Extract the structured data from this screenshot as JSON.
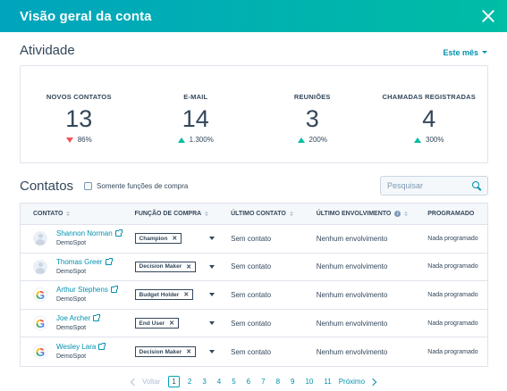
{
  "header": {
    "title": "Visão geral da conta"
  },
  "activity": {
    "title": "Atividade",
    "period": "Este mês",
    "stats": [
      {
        "label": "NOVOS CONTATOS",
        "value": "13",
        "change": "86%",
        "trend": "down"
      },
      {
        "label": "E-MAIL",
        "value": "14",
        "change": "1.300%",
        "trend": "up"
      },
      {
        "label": "REUNIÕES",
        "value": "3",
        "change": "200%",
        "trend": "up"
      },
      {
        "label": "CHAMADAS REGISTRADAS",
        "value": "4",
        "change": "300%",
        "trend": "up"
      }
    ]
  },
  "contacts": {
    "title": "Contatos",
    "filter_label": "Somente funções de compra",
    "search_placeholder": "Pesquisar",
    "columns": [
      "CONTATO",
      "FUNÇÃO DE COMPRA",
      "ÚLTIMO CONTATO",
      "ÚLTIMO ENVOLVIMENTO",
      "PROGRAMADO"
    ],
    "rows": [
      {
        "name": "Shannon Norman",
        "company": "DemoSpot",
        "avatar": "person-icon",
        "role": "Champion",
        "last_contact": "Sem contato",
        "engagement": "Nenhum envolvimento",
        "scheduled": "Nada programado"
      },
      {
        "name": "Thomas Greer",
        "company": "DemoSpot",
        "avatar": "person-icon",
        "role": "Decision Maker",
        "last_contact": "Sem contato",
        "engagement": "Nenhum envolvimento",
        "scheduled": "Nada programado"
      },
      {
        "name": "Arthur Stephens",
        "company": "DemoSpot",
        "avatar": "google-icon",
        "role": "Budget Holder",
        "last_contact": "Sem contato",
        "engagement": "Nenhum envolvimento",
        "scheduled": "Nada programado"
      },
      {
        "name": "Joe Archer",
        "company": "DemoSpot",
        "avatar": "google-icon",
        "role": "End User",
        "last_contact": "Sem contato",
        "engagement": "Nenhum envolvimento",
        "scheduled": "Nada programado"
      },
      {
        "name": "Wesley Lara",
        "company": "DemoSpot",
        "avatar": "google-icon",
        "role": "Decision Maker",
        "last_contact": "Sem contato",
        "engagement": "Nenhum envolvimento",
        "scheduled": "Nada programado"
      }
    ]
  },
  "pagination": {
    "prev": "Voltar",
    "next": "Próximo",
    "pages": [
      "1",
      "2",
      "3",
      "4",
      "5",
      "6",
      "7",
      "8",
      "9",
      "10",
      "11"
    ],
    "current": "1"
  },
  "colors": {
    "accent": "#0091ae",
    "header_start": "#00a4bd",
    "header_end": "#00bda5",
    "up": "#00bda5",
    "down": "#f2545b"
  }
}
